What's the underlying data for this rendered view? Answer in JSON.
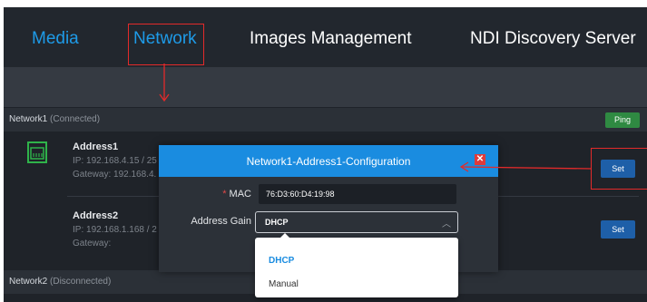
{
  "nav": {
    "items": [
      {
        "label": "Media"
      },
      {
        "label": "Network"
      },
      {
        "label": "Images Management"
      },
      {
        "label": "NDI Discovery Server"
      }
    ]
  },
  "network1": {
    "title": "Network1",
    "status": "(Connected)",
    "ping_label": "Ping",
    "addresses": [
      {
        "name": "Address1",
        "ip": "IP: 192.168.4.15 / 25",
        "gateway": "Gateway: 192.168.4.",
        "set_label": "Set"
      },
      {
        "name": "Address2",
        "ip": "IP: 192.168.1.168 / 2",
        "gateway": "Gateway:",
        "set_label": "Set"
      }
    ]
  },
  "network2": {
    "title": "Network2",
    "status": "(Disconnected)"
  },
  "modal": {
    "title": "Network1-Address1-Configuration",
    "mac_label": "MAC",
    "mac_required_mark": "*",
    "mac_value": "76:D3:60:D4:19:98",
    "gain_label": "Address Gain",
    "gain_value": "DHCP",
    "options": [
      "DHCP",
      "Manual"
    ]
  },
  "icons": {
    "port": "ethernet-port-icon",
    "close": "close-icon",
    "chevron": "chevron-up-icon"
  },
  "colors": {
    "accent": "#1a8ce0",
    "nav_active": "#1e9be8",
    "ping_green": "#2f8a42",
    "set_blue": "#1e5fa8",
    "annotation_red": "#e32a2a",
    "port_green": "#2fb34a"
  }
}
